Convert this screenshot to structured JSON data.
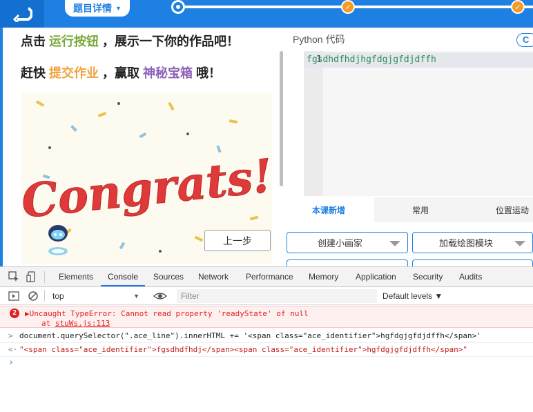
{
  "header": {
    "title_pill": "题目详情",
    "done_mark": "✓"
  },
  "lesson": {
    "line1": {
      "pre": "点击 ",
      "hl": "运行按钮",
      "post": " ，展示一下你的作品吧！"
    },
    "line2": {
      "pre": "赶快 ",
      "hl1": "提交作业",
      "mid": " ，赢取 ",
      "hl2": "神秘宝箱",
      "post": " 哦！"
    },
    "image_text": "Congrats!",
    "prev_button": "上一步"
  },
  "editor": {
    "title": "Python 代码",
    "line_number": "1",
    "code": "fgsdhdfhdjhgfdgjgfdjdffh"
  },
  "blocks": {
    "tabs": [
      "本课新增",
      "常用",
      "位置运动"
    ],
    "buttons": [
      "创建小画家",
      "加载绘图模块"
    ]
  },
  "devtools": {
    "tabs": [
      "Elements",
      "Console",
      "Sources",
      "Network",
      "Performance",
      "Memory",
      "Application",
      "Security",
      "Audits"
    ],
    "context": "top",
    "filter_placeholder": "Filter",
    "levels": "Default levels ▼",
    "error_count": "2",
    "error_message": "Uncaught TypeError: Cannot read property 'readyState' of null",
    "error_at": "at ",
    "error_source": "stuWs.js:113",
    "input_command": "document.querySelector(\".ace_line\").innerHTML += '<span class=\"ace_identifier\">hgfdgjgfdjdffh</span>'",
    "output_result": "\"<span class=\"ace_identifier\">fgsdhdfhdj</span><span class=\"ace_identifier\">hgfdgjgfdjdffh</span>\""
  },
  "colors": {
    "brand_blue": "#1e80e2",
    "accent_orange": "#f59a23",
    "error_red": "#e02020",
    "code_green": "#2e8b57"
  }
}
